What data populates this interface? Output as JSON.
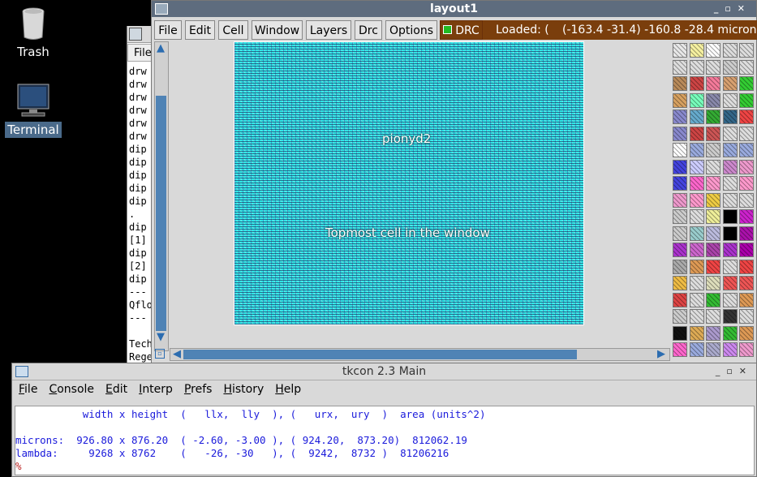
{
  "desktop": {
    "icons": [
      {
        "label": "Trash",
        "icon": "trash-icon"
      },
      {
        "label": "Terminal",
        "icon": "monitor-icon"
      }
    ]
  },
  "terminal": {
    "menu_file": "File",
    "lines": [
      "drw",
      "drw",
      "drw",
      "drw",
      "drw",
      "drw",
      "dip",
      "dip",
      "dip",
      "dip",
      "dip",
      ".",
      "dip",
      "[1]",
      "dip",
      "[2]",
      "dip",
      "---",
      "Qflo",
      "---",
      "",
      "Tech",
      "Rege"
    ]
  },
  "layout": {
    "title": "layout1",
    "menus": [
      "File",
      "Edit",
      "Cell",
      "Window",
      "Layers",
      "Drc",
      "Options"
    ],
    "drc_label": "DRC",
    "status_loaded": "Loaded: (",
    "status_coords": "(-163.4 -31.4) -160.8 -28.4 microns",
    "canvas_label_cell": "pionyd2",
    "canvas_label_top": "Topmost cell in the window",
    "colors": {
      "title_bar": "#5e6c7e",
      "status_bg": "#7a3e0c",
      "canvas": "#2ee6e6",
      "scroll_thumb": "#4f83b5"
    }
  },
  "tkcon": {
    "title": "tkcon 2.3 Main",
    "menus": [
      "File",
      "Console",
      "Edit",
      "Interp",
      "Prefs",
      "History",
      "Help"
    ],
    "console_lines": [
      "           width x height  (   llx,  lly  ), (   urx,  ury  )  area (units^2)",
      "",
      "microns:  926.80 x 876.20  ( -2.60, -3.00 ), ( 924.20,  873.20)  812062.19",
      "lambda:     9268 x 8762    (   -26, -30   ), (  9242,  8732 )  81206216"
    ],
    "prompt": "%"
  }
}
